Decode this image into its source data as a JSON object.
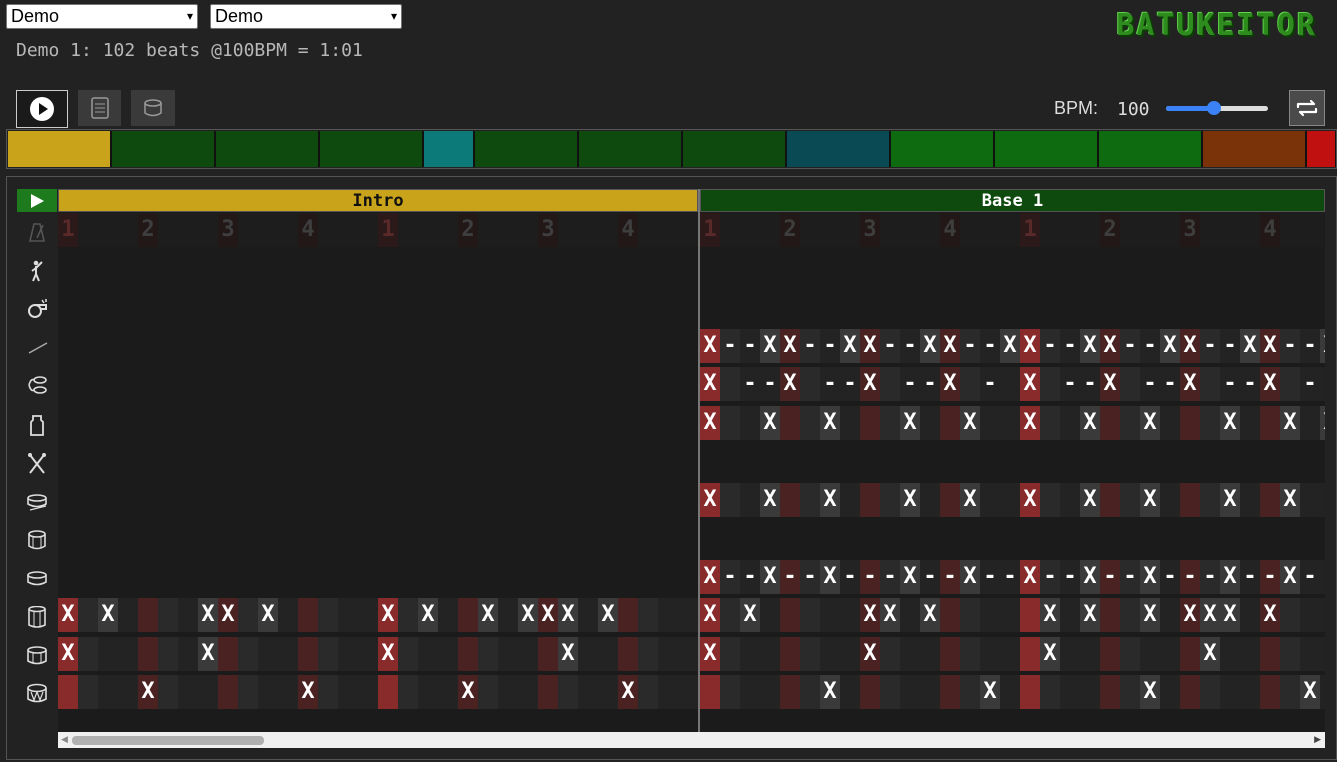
{
  "selects": {
    "score": "Demo",
    "arrangement": "Demo"
  },
  "logo": "BATUKEITOR",
  "info": "Demo 1: 102 beats @100BPM = 1:01",
  "toolbar": {
    "bpm_label": "BPM:",
    "bpm_value": "100",
    "bpm_slider_level": 0.47
  },
  "overview_colors": [
    "#c9a41b",
    "#0e4a0e",
    "#0e4a0e",
    "#0e4a0e",
    "#0d7a7a",
    "#0e4a0e",
    "#0e4a0e",
    "#0e4a0e",
    "#0a4a55",
    "#0f6b0f",
    "#0f6b0f",
    "#0f6b0f",
    "#7a3208",
    "#c01010"
  ],
  "sections": [
    {
      "title": "Intro",
      "color": "#c9a41b",
      "text_color": "#111"
    },
    {
      "title": "Base 1",
      "color": "#0e4a0e",
      "text_color": "#fff"
    }
  ],
  "beat_labels": [
    "1",
    "2",
    "3",
    "4",
    "1",
    "2",
    "3",
    "4",
    "1",
    "2",
    "3",
    "4",
    "1",
    "2",
    "3",
    "4"
  ],
  "instruments": [
    "metronome-icon",
    "conductor-icon",
    "whistle-icon",
    "stick-icon",
    "agogo-icon",
    "shaker-icon",
    "crossed-sticks-icon",
    "snare-icon",
    "repinique-icon",
    "caixa-icon",
    "surdo-1-icon",
    "surdo-2-icon",
    "surdo-3-icon"
  ],
  "tracks": [
    "................................................................",
    "................................................................",
    "................................................................",
    "................................X--XX--XX--XX--XX--XX--XX--XX--X",
    "................................X.--X.--X.--X.-.X.--X.--X.--X.-.",
    "................................X..X..X...X..X..X..X..X...X..X.X",
    "................................................................",
    "................................X..X..X...X..X..X..X..X...X..X..",
    "................................................................",
    "................................X--X--X---X--X--X--X--X---X--X-.",
    "X.X....XX.X.....X.X..X.XXX.X....X.X.....XX.X.....X.X..X.XXX.X...",
    "X......X........X........X......X.......X........X.......X......",
    "....X.......X.......X.......X.........X.......X.......X.......X."
  ]
}
